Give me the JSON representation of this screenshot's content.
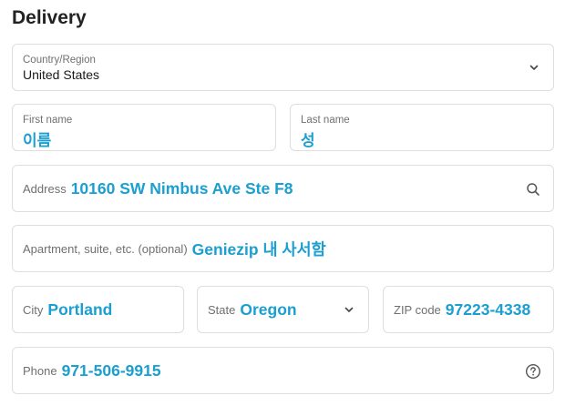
{
  "heading": "Delivery",
  "country": {
    "label": "Country/Region",
    "value": "United States",
    "icon": "chevron-down-icon"
  },
  "first_name": {
    "label": "First name",
    "value": "이름"
  },
  "last_name": {
    "label": "Last name",
    "value": "성"
  },
  "address": {
    "label": "Address",
    "value": "10160 SW Nimbus Ave Ste F8",
    "icon": "search-icon"
  },
  "apartment": {
    "label": "Apartment, suite, etc. (optional)",
    "value": "Geniezip 내 사서함"
  },
  "city": {
    "label": "City",
    "value": "Portland"
  },
  "state": {
    "label": "State",
    "value": "Oregon",
    "icon": "chevron-down-icon"
  },
  "zip": {
    "label": "ZIP code",
    "value": "97223-4338"
  },
  "phone": {
    "label": "Phone",
    "value": "971-506-9915",
    "icon": "help-icon"
  },
  "colors": {
    "accent_overlay": "#1b9fd0",
    "border": "#dedede",
    "label": "#707070"
  }
}
